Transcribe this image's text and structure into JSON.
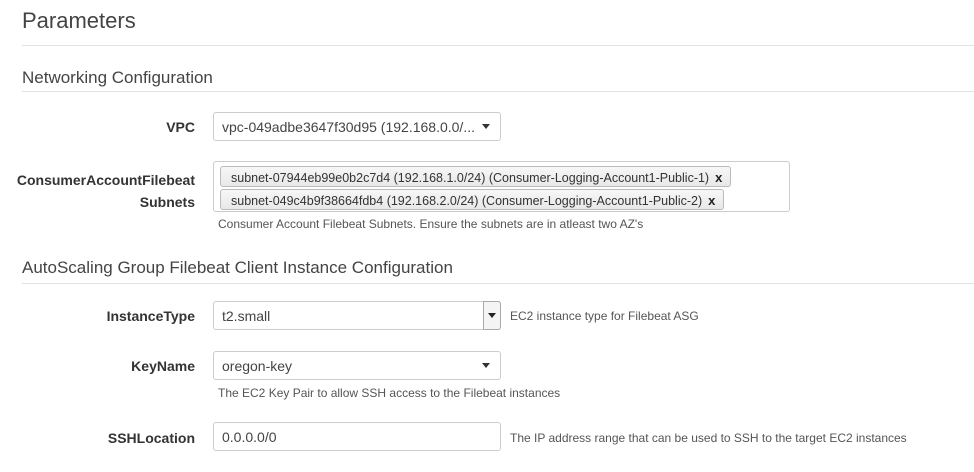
{
  "title": "Parameters",
  "sections": {
    "networking": {
      "heading": "Networking Configuration",
      "vpc": {
        "label": "VPC",
        "value": "vpc-049adbe3647f30d95 (192.168.0.0/..."
      },
      "subnets": {
        "label_line1": "ConsumerAccountFilebeat",
        "label_line2": "Subnets",
        "tags": [
          "subnet-07944eb99e0b2c7d4 (192.168.1.0/24) (Consumer-Logging-Account1-Public-1)",
          "subnet-049c4b9f38664fdb4 (192.168.2.0/24) (Consumer-Logging-Account1-Public-2)"
        ],
        "remove_glyph": "x",
        "help": "Consumer Account Filebeat Subnets. Ensure the subnets are in atleast two AZ's"
      }
    },
    "asg": {
      "heading": "AutoScaling Group Filebeat Client Instance Configuration",
      "instance_type": {
        "label": "InstanceType",
        "value": "t2.small",
        "help": "EC2 instance type for Filebeat ASG"
      },
      "key_name": {
        "label": "KeyName",
        "value": "oregon-key",
        "help": "The EC2 Key Pair to allow SSH access to the Filebeat instances"
      },
      "ssh_location": {
        "label": "SSHLocation",
        "value": "0.0.0.0/0",
        "help": "The IP address range that can be used to SSH to the target EC2 instances"
      }
    }
  }
}
